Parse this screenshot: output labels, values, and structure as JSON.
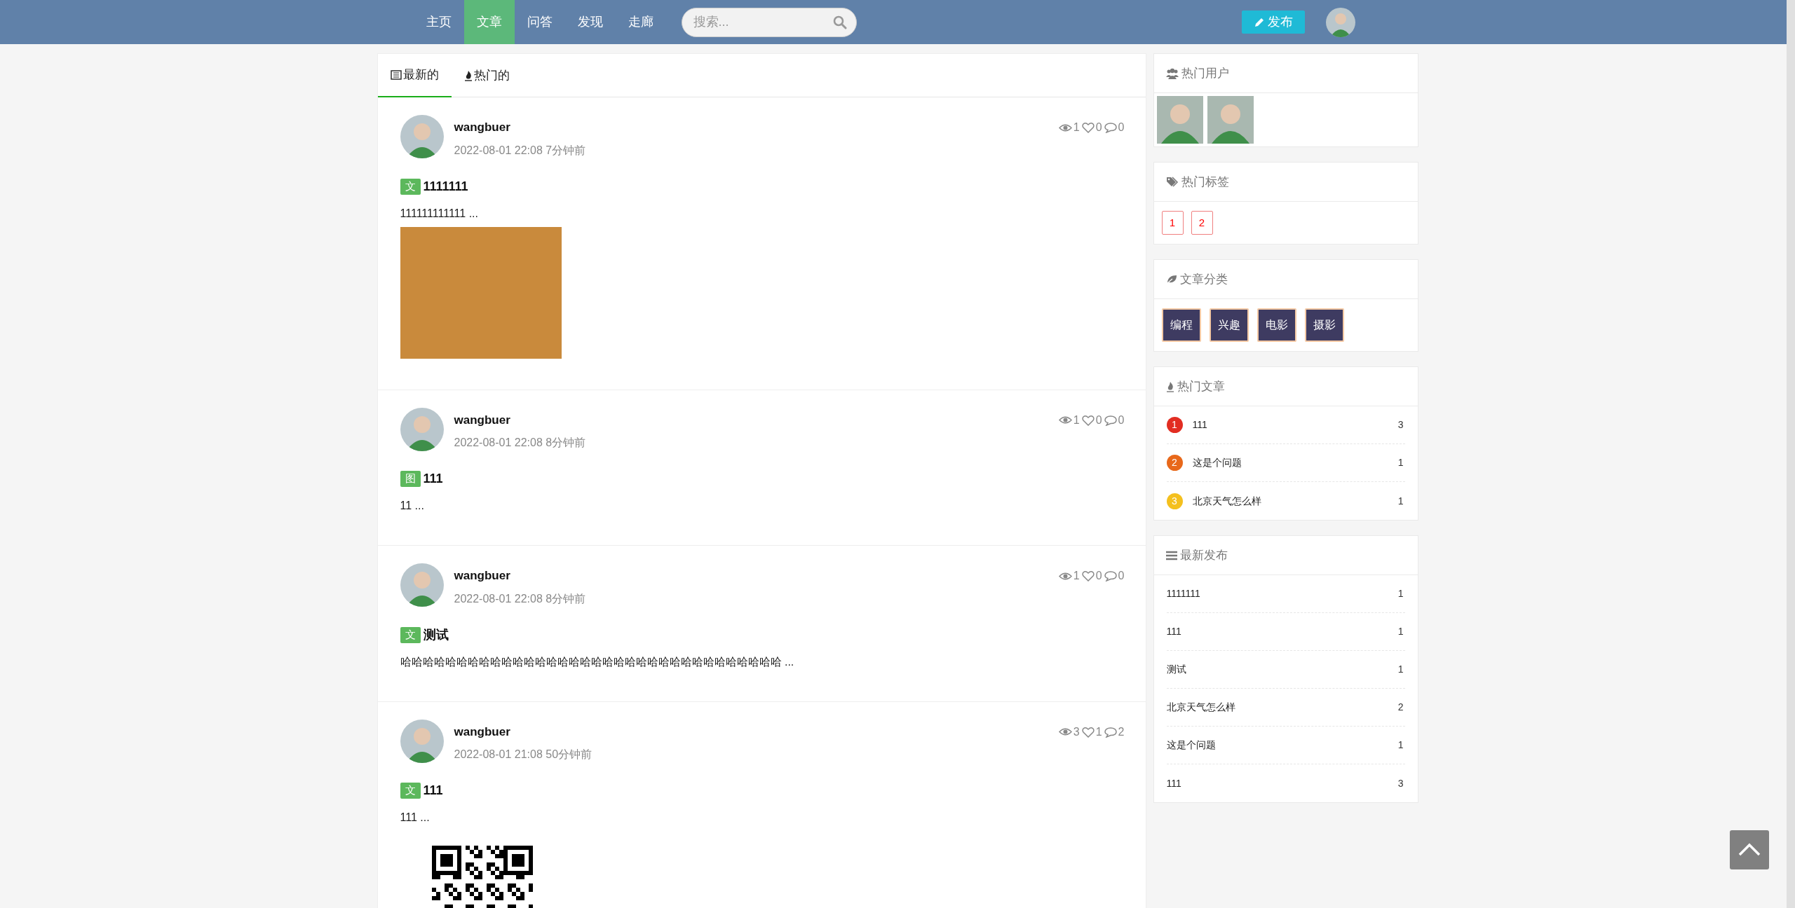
{
  "nav": {
    "items": [
      {
        "label": "主页",
        "selected": false
      },
      {
        "label": "文章",
        "selected": true
      },
      {
        "label": "问答",
        "selected": false
      },
      {
        "label": "发现",
        "selected": false
      },
      {
        "label": "走廊",
        "selected": false
      }
    ],
    "search": {
      "placeholder": "搜索..."
    },
    "publish_button": "发布"
  },
  "feed": {
    "tabs": [
      {
        "label": "最新的",
        "selected": true,
        "kind": "newest"
      },
      {
        "label": "热门的",
        "selected": false,
        "kind": "hot"
      }
    ],
    "posts": [
      {
        "author": "wangbuer",
        "time": "2022-08-01 22:08 7分钟前",
        "views": "1",
        "likes": "0",
        "comments": "0",
        "badge": "文",
        "title": "1111111",
        "summary": "111111111111 ...",
        "kind": "photo"
      },
      {
        "author": "wangbuer",
        "time": "2022-08-01 22:08 8分钟前",
        "views": "1",
        "likes": "0",
        "comments": "0",
        "badge": "图",
        "title": "111",
        "summary": "11 ..."
      },
      {
        "author": "wangbuer",
        "time": "2022-08-01 22:08 8分钟前",
        "views": "1",
        "likes": "0",
        "comments": "0",
        "badge": "文",
        "title": "测试",
        "summary": "哈哈哈哈哈哈哈哈哈哈哈哈哈哈哈哈哈哈哈哈哈哈哈哈哈哈哈哈哈哈哈哈哈哈 ..."
      },
      {
        "author": "wangbuer",
        "time": "2022-08-01 21:08 50分钟前",
        "views": "3",
        "likes": "1",
        "comments": "2",
        "badge": "文",
        "title": "111",
        "summary": "111 ...",
        "kind": "qr"
      }
    ]
  },
  "sidebar": {
    "hot_users": {
      "title": "热门用户",
      "users": [
        {
          "kind": "photo"
        },
        {
          "kind": "photo"
        }
      ]
    },
    "hot_tags": {
      "title": "热门标签",
      "tags": [
        "1",
        "2"
      ]
    },
    "categories": {
      "title": "文章分类",
      "items": [
        "编程",
        "兴趣",
        "电影",
        "摄影"
      ]
    },
    "hot_articles": {
      "title": "热门文章",
      "items": [
        {
          "rank": "1",
          "title": "111",
          "count": "3",
          "color": "#e22d22"
        },
        {
          "rank": "2",
          "title": "这是个问题",
          "count": "1",
          "color": "#e8681a"
        },
        {
          "rank": "3",
          "title": "北京天气怎么样",
          "count": "1",
          "color": "#f4c01e"
        }
      ]
    },
    "latest": {
      "title": "最新发布",
      "items": [
        {
          "title": "1111111",
          "count": "1"
        },
        {
          "title": "111",
          "count": "1"
        },
        {
          "title": "测试",
          "count": "1"
        },
        {
          "title": "北京天气怎么样",
          "count": "2"
        },
        {
          "title": "这是个问题",
          "count": "1"
        },
        {
          "title": "111",
          "count": "3"
        }
      ]
    }
  }
}
